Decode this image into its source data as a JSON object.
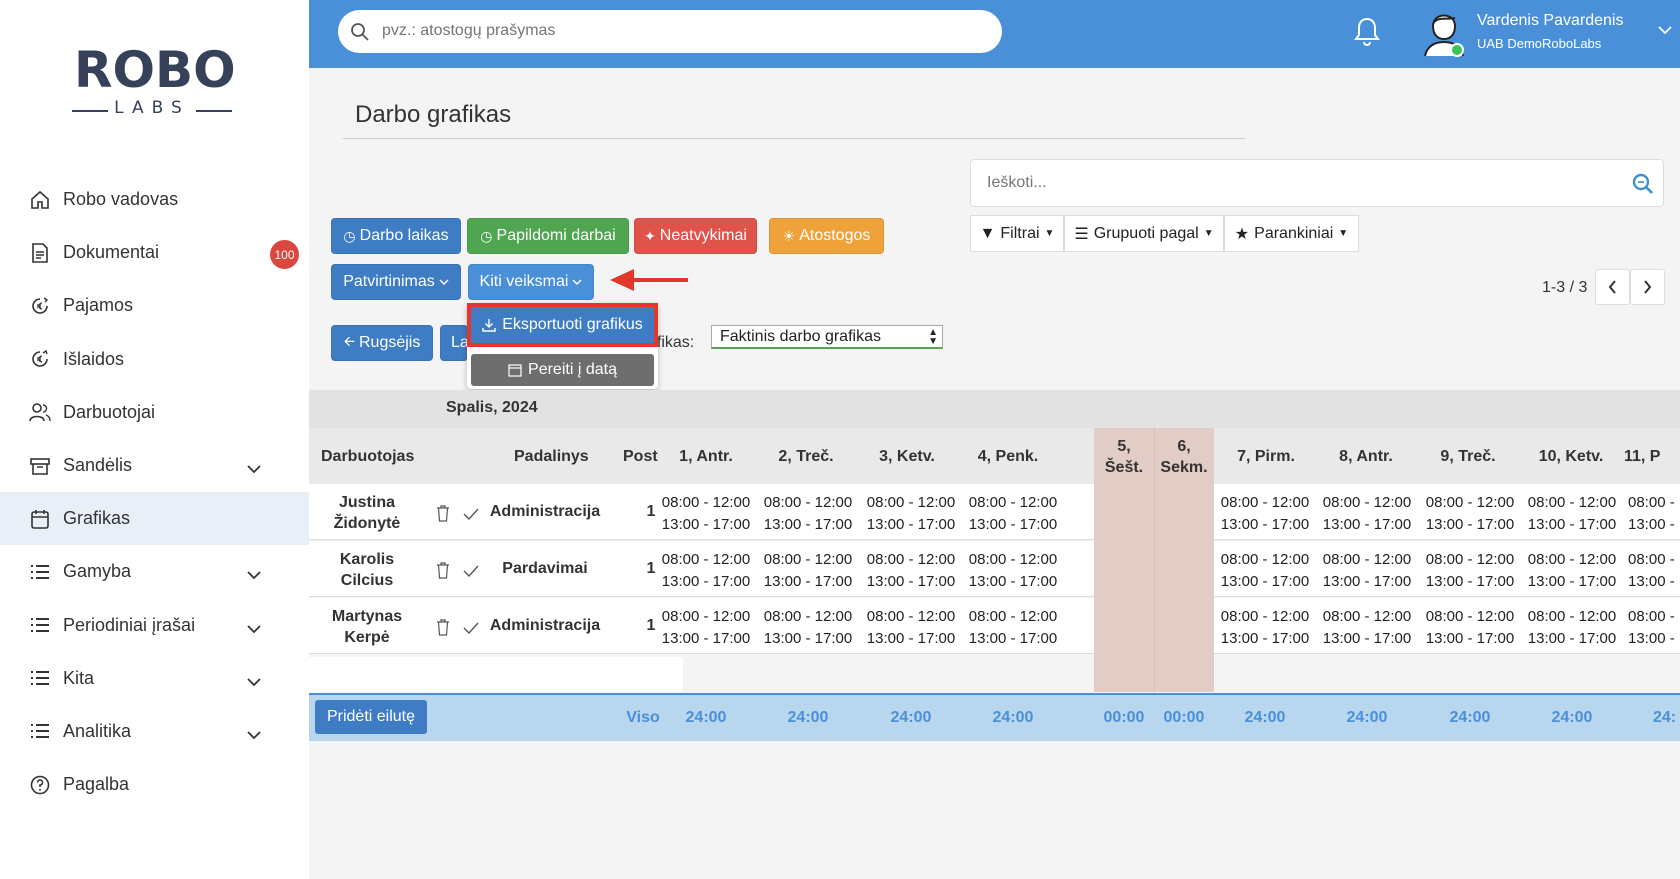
{
  "sidebar": {
    "logo_top": "ROBO",
    "logo_bottom": "LABS",
    "items": [
      {
        "label": "Robo vadovas"
      },
      {
        "label": "Dokumentai",
        "badge": "100"
      },
      {
        "label": "Pajamos"
      },
      {
        "label": "Išlaidos"
      },
      {
        "label": "Darbuotojai"
      },
      {
        "label": "Sandėlis"
      },
      {
        "label": "Grafikas"
      },
      {
        "label": "Gamyba"
      },
      {
        "label": "Periodiniai įrašai"
      },
      {
        "label": "Kita"
      },
      {
        "label": "Analitika"
      },
      {
        "label": "Pagalba"
      }
    ]
  },
  "topbar": {
    "search_placeholder": "pvz.: atostogų prašymas",
    "user_name": "Vardenis Pavardenis",
    "company": "UAB DemoRoboLabs"
  },
  "page": {
    "title": "Darbo grafikas",
    "buttons": {
      "work_time": "Darbo laikas",
      "extra_work": "Papildomi darbai",
      "absences": "Neatvykimai",
      "vacations": "Atostogos",
      "confirmation": "Patvirtinimas",
      "other_actions": "Kiti veiksmai",
      "prev_month": "Rugsėjis",
      "next_month_partial": "La"
    },
    "dropdown": {
      "export": "Eksportuoti grafikus",
      "goto_date": "Pereiti į datą"
    },
    "search_placeholder": "Ieškoti...",
    "filters": "Filtrai",
    "group_by": "Grupuoti pagal",
    "favorites": "Parankiniai",
    "pager": "1-3 / 3",
    "grafikas_label_partial": "afikas:",
    "grafikas_select": "Faktinis darbo grafikas"
  },
  "schedule": {
    "month": "Spalis, 2024",
    "headers": {
      "employee": "Darbuotojas",
      "department": "Padalinys",
      "post": "Post"
    },
    "days": [
      {
        "l1": "1, Antr.",
        "l2": ""
      },
      {
        "l1": "2, Treč.",
        "l2": ""
      },
      {
        "l1": "3, Ketv.",
        "l2": ""
      },
      {
        "l1": "4, Penk.",
        "l2": ""
      },
      {
        "l1": "5,",
        "l2": "Šešt."
      },
      {
        "l1": "6,",
        "l2": "Sekm."
      },
      {
        "l1": "7, Pirm.",
        "l2": ""
      },
      {
        "l1": "8, Antr.",
        "l2": ""
      },
      {
        "l1": "9, Treč.",
        "l2": ""
      },
      {
        "l1": "10, Ketv.",
        "l2": ""
      },
      {
        "l1": "11, P",
        "l2": ""
      }
    ],
    "rows": [
      {
        "name1": "Justina",
        "name2": "Židonytė",
        "dept": "Administracija",
        "post": "1"
      },
      {
        "name1": "Karolis",
        "name2": "Cilcius",
        "dept": "Pardavimai",
        "post": "1"
      },
      {
        "name1": "Martynas",
        "name2": "Kerpė",
        "dept": "Administracija",
        "post": "1"
      }
    ],
    "shift1": "08:00 - 12:00",
    "shift2": "13:00 - 17:00",
    "shift1_partial": "08:00 -",
    "shift2_partial": "13:00 -",
    "add_row": "Pridėti eilutę",
    "total_label": "Viso",
    "totals": [
      "24:00",
      "24:00",
      "24:00",
      "24:00",
      "00:00",
      "00:00",
      "24:00",
      "24:00",
      "24:00",
      "24:00",
      "24:"
    ]
  },
  "colors": {
    "topbar": "#4a90d9",
    "primary": "#3e7cc4",
    "green": "#4fa550",
    "red": "#e0534a",
    "orange": "#f0a23a",
    "weekend": "#e2cdc6",
    "highlight": "#e2372a"
  }
}
